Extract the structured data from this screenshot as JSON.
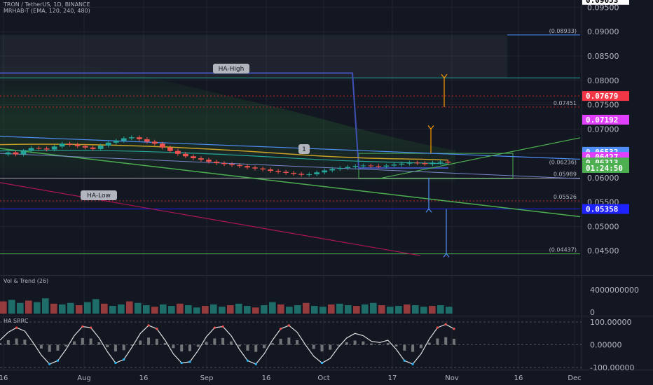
{
  "header": {
    "symbol": "TRON / TetherUS, 1D, BINANCE",
    "indicator": "MRHAB-T (EMA, 120, 240, 480)",
    "volume_title": "Vol & Trend (26)",
    "osc_title": "HA SRRC"
  },
  "colors": {
    "background": "#131722",
    "grid": "#1f2430",
    "axis_text": "#b2b5be",
    "up": "#26a69a",
    "down": "#ef5350",
    "green_line": "#4caf50",
    "blue_line": "#2962ff",
    "orange": "#ff9800",
    "magenta": "#e91e63"
  },
  "chart_data": [
    {
      "type": "candlestick",
      "title": "TRON / TetherUS, 1D, BINANCE",
      "ylim": [
        0.04,
        0.0965
      ],
      "y_ticks": [
        "0.09500",
        "0.09000",
        "0.08500",
        "0.08000",
        "0.07500",
        "0.07000",
        "0.06500",
        "0.06000",
        "0.05500",
        "0.05000",
        "0.04500"
      ],
      "x_ticks": [
        "16",
        "Aug",
        "16",
        "Sep",
        "16",
        "Oct",
        "17",
        "Nov",
        "16",
        "Dec"
      ],
      "price_tags": [
        {
          "label": "0.09653",
          "value": 0.09653,
          "bg": "#ffffff",
          "fg": "#000000"
        },
        {
          "label": "0.07679",
          "value": 0.07679,
          "bg": "#f23645",
          "fg": "#ffffff"
        },
        {
          "label": "0.07192",
          "value": 0.07192,
          "bg": "#e040fb",
          "fg": "#ffffff"
        },
        {
          "label": "0.06532",
          "value": 0.06532,
          "bg": "#4f8ff7",
          "fg": "#ffffff"
        },
        {
          "label": "0.06427",
          "value": 0.06427,
          "bg": "#e040fb",
          "fg": "#ffffff"
        },
        {
          "label": "0.06313",
          "value": 0.06313,
          "bg": "#4caf50",
          "fg": "#ffffff"
        },
        {
          "label": "01:24:50",
          "value": 0.062,
          "bg": "#4caf50",
          "fg": "#ffffff"
        },
        {
          "label": "0.05358",
          "value": 0.05358,
          "bg": "#1e22ff",
          "fg": "#ffffff"
        }
      ],
      "levels": [
        {
          "label": "(0.08933)",
          "value": 0.08933
        },
        {
          "label": "0.07451",
          "value": 0.07451
        },
        {
          "label": "(0.06236)",
          "value": 0.06236
        },
        {
          "label": "0.05989",
          "value": 0.05989
        },
        {
          "label": "0.05526",
          "value": 0.05526
        },
        {
          "label": "(0.04437)",
          "value": 0.04437
        }
      ],
      "annotations": [
        "HA-High",
        "HA-Low",
        "1"
      ],
      "series": [
        {
          "name": "TRX/USDT close",
          "values": [
            0.0652,
            0.0648,
            0.0655,
            0.0661,
            0.066,
            0.0658,
            0.0664,
            0.067,
            0.0668,
            0.0665,
            0.0662,
            0.0659,
            0.0666,
            0.0672,
            0.0676,
            0.0681,
            0.0683,
            0.0679,
            0.0674,
            0.067,
            0.0662,
            0.0655,
            0.0649,
            0.0644,
            0.064,
            0.0637,
            0.0633,
            0.063,
            0.0628,
            0.0626,
            0.0624,
            0.0621,
            0.0619,
            0.0617,
            0.0614,
            0.0612,
            0.061,
            0.0608,
            0.0606,
            0.0607,
            0.0611,
            0.0615,
            0.0618,
            0.062,
            0.0622,
            0.0624,
            0.0625,
            0.0624,
            0.0623,
            0.0625,
            0.0627,
            0.0629,
            0.0631,
            0.063,
            0.0628,
            0.0631,
            0.0633,
            0.0631
          ]
        }
      ]
    },
    {
      "type": "bar",
      "title": "Vol & Trend (26)",
      "y_ticks": [
        "4000000000",
        "0"
      ],
      "series": [
        {
          "name": "Volume",
          "values": [
            1.6,
            1.8,
            1.4,
            1.7,
            1.5,
            2.0,
            1.3,
            1.2,
            1.4,
            1.1,
            1.5,
            1.9,
            1.3,
            1.0,
            1.2,
            1.6,
            1.4,
            1.1,
            0.9,
            1.2,
            1.0,
            1.3,
            1.1,
            0.8,
            1.0,
            1.2,
            0.9,
            1.1,
            1.3,
            1.0,
            0.8,
            1.1,
            1.5,
            1.2,
            0.9,
            1.1,
            1.4,
            1.0,
            0.9,
            1.2,
            1.3,
            1.1,
            1.0,
            1.2,
            1.4,
            1.1,
            0.9,
            1.0,
            1.2,
            1.1,
            0.9,
            1.0,
            1.1,
            0.9
          ]
        }
      ]
    },
    {
      "type": "line",
      "title": "HA SRRC",
      "ylim": [
        -100,
        100
      ],
      "y_ticks": [
        "100.00000",
        "0.00000",
        "-100.00000"
      ],
      "series": [
        {
          "name": "oscillator",
          "values": [
            20,
            55,
            75,
            60,
            10,
            -45,
            -85,
            -70,
            -20,
            40,
            80,
            75,
            30,
            -30,
            -80,
            -65,
            -10,
            50,
            85,
            70,
            20,
            -40,
            -80,
            -75,
            -25,
            35,
            75,
            80,
            40,
            -20,
            -70,
            -85,
            -40,
            20,
            70,
            85,
            55,
            0,
            -50,
            -80,
            -60,
            -10,
            30,
            50,
            40,
            15,
            10,
            20,
            -20,
            -70,
            -85,
            -40,
            25,
            75,
            90,
            70
          ]
        }
      ]
    }
  ]
}
